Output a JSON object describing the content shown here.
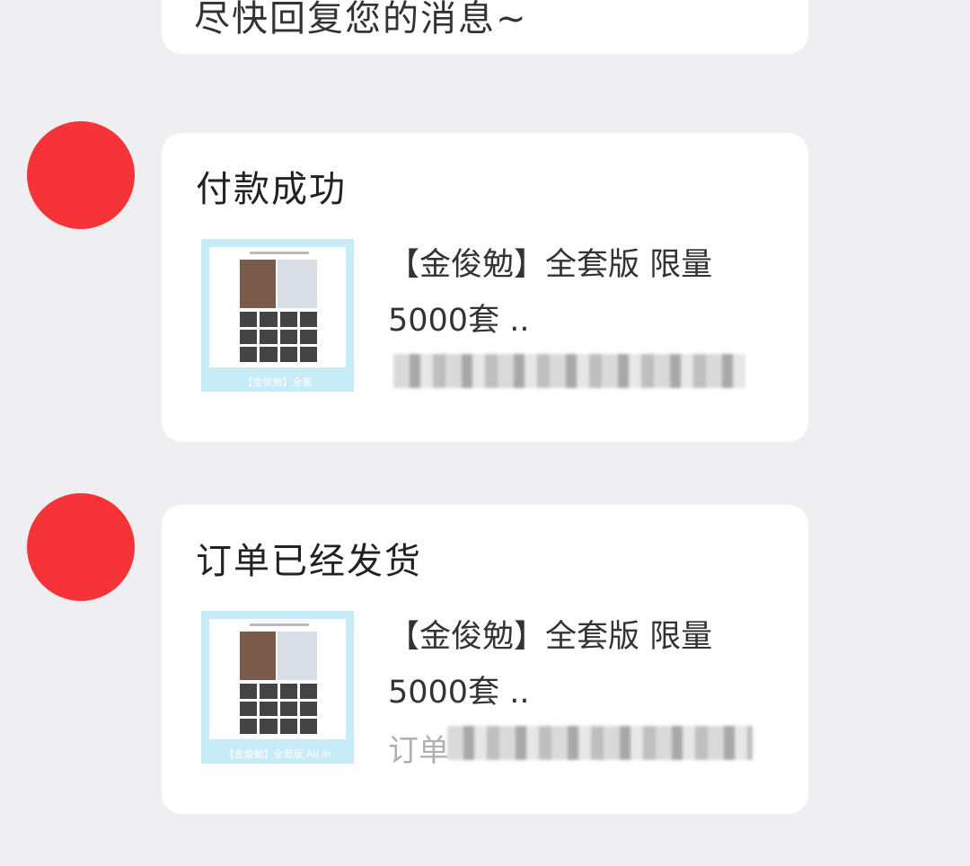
{
  "top_message": {
    "text": "尽快回复您的消息~"
  },
  "messages": [
    {
      "title": "付款成功",
      "product_text": "【金俊勉】全套版 限量5000套 ..",
      "thumb_caption": "【金俊勉】全套",
      "detail_prefix": ""
    },
    {
      "title": "订单已经发货",
      "product_text": "【金俊勉】全套版 限量5000套 ..",
      "thumb_caption": "【金俊勉】全套版 All in",
      "detail_prefix": "订单"
    }
  ],
  "colors": {
    "avatar": "#f7333a",
    "thumb_border": "#c7ebf7",
    "background": "#efeff2"
  }
}
